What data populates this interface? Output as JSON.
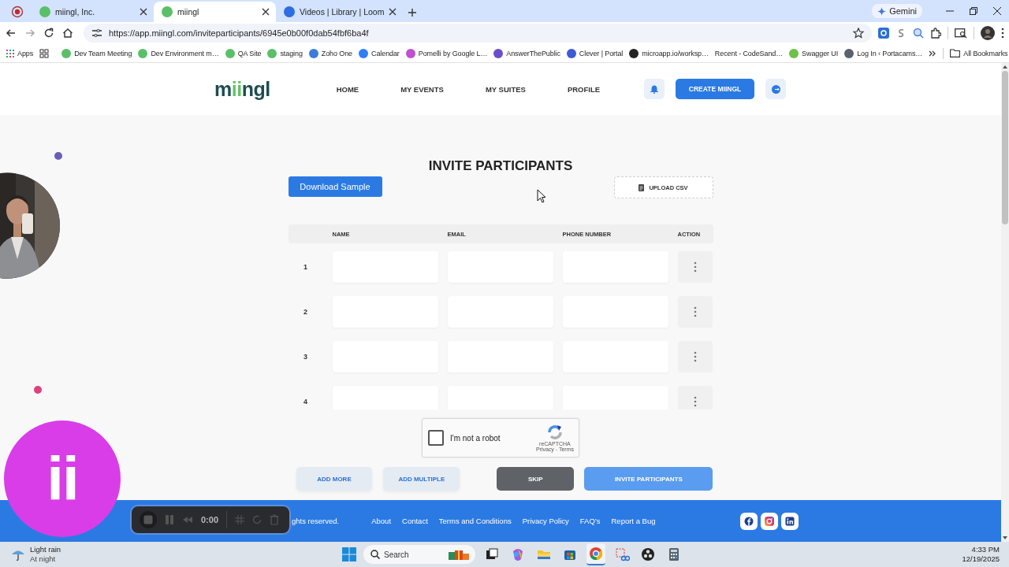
{
  "browser": {
    "tabs": [
      {
        "title": "miingl, Inc.",
        "selected": false,
        "color": "#5bbf6a"
      },
      {
        "title": "miingl",
        "selected": true,
        "color": "#5bbf6a"
      },
      {
        "title": "Videos | Library | Loom",
        "selected": false,
        "color": "#2f6ee0"
      }
    ],
    "gemini": "Gemini",
    "url": "https://app.miingl.com/inviteparticipants/6945e0b00f0dab54fbf6ba4f",
    "apps": "Apps",
    "bookmarks": [
      {
        "label": "Dev Team Meeting",
        "color": "#5bbf6a"
      },
      {
        "label": "Dev Environment m…",
        "color": "#5bbf6a"
      },
      {
        "label": "QA Site",
        "color": "#5bbf6a"
      },
      {
        "label": "staging",
        "color": "#5bbf6a"
      },
      {
        "label": "Zoho One",
        "color": "#3b7dd8"
      },
      {
        "label": "Calendar",
        "color": "#2d7ff9"
      },
      {
        "label": "Pomelli by Google L…",
        "color": "#c04fd1"
      },
      {
        "label": "AnswerThePublic",
        "color": "#6a4fc9"
      },
      {
        "label": "Clever | Portal",
        "color": "#3d5bd6"
      },
      {
        "label": "microapp.io/worksp…",
        "color": "#222222"
      },
      {
        "label": "Recent - CodeSand…"
      },
      {
        "label": "Swagger UI",
        "color": "#6cc04a"
      },
      {
        "label": "Log In ‹ Portacams…",
        "color": "#5a6170"
      }
    ],
    "all_bookmarks": "All Bookmarks"
  },
  "site": {
    "logo": "miingl",
    "nav": [
      "HOME",
      "MY EVENTS",
      "MY SUITES",
      "PROFILE"
    ],
    "create_button": "CREATE MIINGL"
  },
  "invite": {
    "title": "INVITE PARTICIPANTS",
    "download_button": "Download Sample",
    "upload_button": "UPLOAD CSV",
    "columns": [
      "NAME",
      "EMAIL",
      "PHONE NUMBER",
      "ACTION"
    ],
    "rows": [
      {
        "number": "1"
      },
      {
        "number": "2"
      },
      {
        "number": "3"
      },
      {
        "number": "4"
      }
    ],
    "captcha": {
      "label": "I'm not a robot",
      "checked": false,
      "brand": "reCAPTCHA",
      "links": "Privacy - Terms"
    },
    "actions": [
      {
        "label": "ADD MORE",
        "kind": "secondary"
      },
      {
        "label": "ADD MULTIPLE",
        "kind": "secondary"
      },
      {
        "label": "SKIP",
        "kind": "dark"
      },
      {
        "label": "INVITE PARTICIPANTS",
        "kind": "primary"
      }
    ]
  },
  "footer": {
    "copyright": "ghts reserved.",
    "links": [
      "About",
      "Contact",
      "Terms and Conditions",
      "Privacy Policy",
      "FAQ’s",
      "Report a Bug"
    ],
    "socials": [
      {
        "kind": "facebook"
      },
      {
        "kind": "instagram"
      },
      {
        "kind": "linkedin"
      }
    ]
  },
  "recorder": {
    "time": "0:00",
    "avatar_initials": "ii"
  },
  "taskbar": {
    "weather": {
      "title": "Light rain",
      "subtitle": "At night"
    },
    "search_placeholder": "Search",
    "time": "4:33 PM",
    "date": "12/19/2025"
  }
}
